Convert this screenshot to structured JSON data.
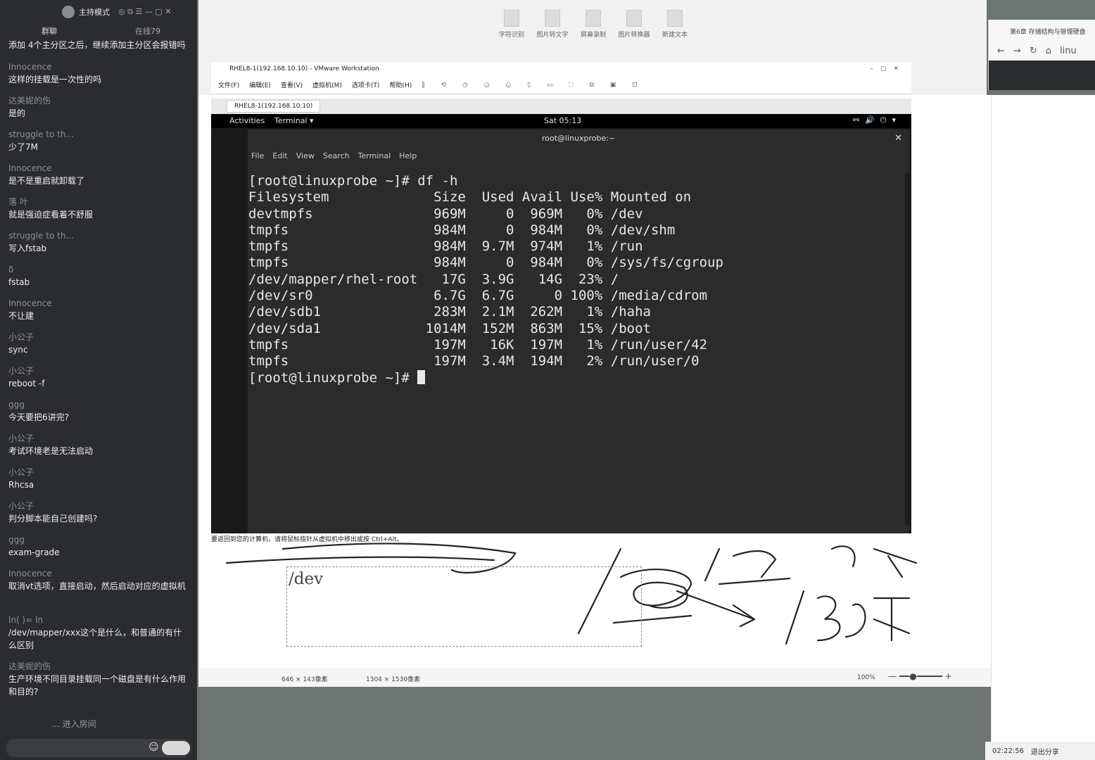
{
  "chat": {
    "host_label": "主持模式",
    "tabs": [
      "群聊",
      "在线79"
    ],
    "first_message": "添加 4个主分区之后，继续添加主分区会报错吗",
    "messages": [
      {
        "user": "Innocence",
        "text": "这样的挂载是一次性的吗"
      },
      {
        "user": "达美妮的伤",
        "text": "是的"
      },
      {
        "user": "struggle to th...",
        "text": "少了7M"
      },
      {
        "user": "Innocence",
        "text": "是不是重启就卸载了"
      },
      {
        "user": "落 叶",
        "text": "就是强迫症看着不舒服"
      },
      {
        "user": "struggle to th...",
        "text": "写入fstab"
      },
      {
        "user": "δ",
        "text": "fstab"
      },
      {
        "user": "Innocence",
        "text": "不让建"
      },
      {
        "user": "小公子",
        "text": "sync"
      },
      {
        "user": "小公子",
        "text": "reboot -f"
      },
      {
        "user": "ggg",
        "text": "今天要把6讲完?"
      },
      {
        "user": "小公子",
        "text": "考试环境老是无法启动"
      },
      {
        "user": "小公子",
        "text": "Rhcsa"
      },
      {
        "user": "小公子",
        "text": "判分脚本能自己创建吗?"
      },
      {
        "user": "ggg",
        "text": "exam-grade"
      },
      {
        "user": "Innocence",
        "text": "取消vt选项，直接启动，然后启动对应的虚拟机"
      },
      {
        "user": "ln(  )=    ln",
        "text": "/dev/mapper/xxx这个是什么，和普通的有什么区别"
      },
      {
        "user": "达美妮的伤",
        "text": "生产环境不同目录挂载同一个磁盘是有什么作用和目的?"
      }
    ],
    "enter_room": "... 进入房间"
  },
  "desktop_icons": [
    "字符识别",
    "图片转文字",
    "屏幕录制",
    "图片转换器",
    "新建文本"
  ],
  "browser": {
    "tab_title": "第6章 存储结构与管理硬盘",
    "url_fragment": "linu"
  },
  "vmware": {
    "title": "RHEL8-1(192.168.10.10) - VMware Workstation",
    "menu": [
      "文件(F)",
      "编辑(E)",
      "查看(V)",
      "虚拟机(M)",
      "选项卡(T)",
      "帮助(H)"
    ],
    "tab": "RHEL8-1(192.168.10.10)",
    "status": "要返回到您的计算机，请将鼠标指针从虚拟机中移出或按 Ctrl+Alt。"
  },
  "gnome": {
    "activities": "Activities",
    "app": "Terminal ▾",
    "clock": "Sat 05:13"
  },
  "terminal": {
    "title": "root@linuxprobe:~",
    "menu": [
      "File",
      "Edit",
      "View",
      "Search",
      "Terminal",
      "Help"
    ],
    "lines": [
      "[root@linuxprobe ~]# df -h",
      "Filesystem             Size  Used Avail Use% Mounted on",
      "devtmpfs               969M     0  969M   0% /dev",
      "tmpfs                  984M     0  984M   0% /dev/shm",
      "tmpfs                  984M  9.7M  974M   1% /run",
      "tmpfs                  984M     0  984M   0% /sys/fs/cgroup",
      "/dev/mapper/rhel-root   17G  3.9G   14G  23% /",
      "/dev/sr0               6.7G  6.7G     0 100% /media/cdrom",
      "/dev/sdb1              283M  2.1M  262M   1% /haha",
      "/dev/sda1             1014M  152M  863M  15% /boot",
      "tmpfs                  197M   16K  197M   1% /run/user/42",
      "tmpfs                  197M  3.4M  194M   2% /run/user/0"
    ],
    "prompt": "[root@linuxprobe ~]# "
  },
  "whiteboard": {
    "dev_text": "/dev",
    "selection_size": "646 × 143像素",
    "canvas_size": "1304 × 1530像素",
    "zoom": "100%"
  },
  "recording": {
    "time": "02:22:56",
    "exit": "退出分享"
  }
}
